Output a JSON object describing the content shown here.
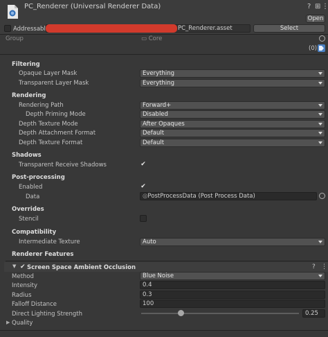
{
  "header": {
    "title": "PC_Renderer (Universal Renderer Data)",
    "open_label": "Open",
    "addressable_label": "Addressable",
    "address_suffix": "PC_Renderer.asset",
    "select_label": "Select",
    "group_label": "Group",
    "group_value": "Core",
    "labels_count": "(0)",
    "folder_glyph": "▭"
  },
  "filtering": {
    "title": "Filtering",
    "opaque_label": "Opaque Layer Mask",
    "opaque_value": "Everything",
    "transparent_label": "Transparent Layer Mask",
    "transparent_value": "Everything"
  },
  "rendering": {
    "title": "Rendering",
    "path_label": "Rendering Path",
    "path_value": "Forward+",
    "priming_label": "Depth Priming Mode",
    "priming_value": "Disabled",
    "texture_mode_label": "Depth Texture Mode",
    "texture_mode_value": "After Opaques",
    "attachment_label": "Depth Attachment Format",
    "attachment_value": "Default",
    "texture_format_label": "Depth Texture Format",
    "texture_format_value": "Default"
  },
  "shadows": {
    "title": "Shadows",
    "receive_label": "Transparent Receive Shadows",
    "receive_checked": true
  },
  "post_processing": {
    "title": "Post-processing",
    "enabled_label": "Enabled",
    "enabled_checked": true,
    "data_label": "Data",
    "data_value": "PostProcessData (Post Process Data)"
  },
  "overrides": {
    "title": "Overrides",
    "stencil_label": "Stencil",
    "stencil_checked": false
  },
  "compatibility": {
    "title": "Compatibility",
    "intermediate_label": "Intermediate Texture",
    "intermediate_value": "Auto"
  },
  "renderer_features": {
    "title": "Renderer Features",
    "ssao": {
      "title": "Screen Space Ambient Occlusion",
      "enabled": true,
      "method_label": "Method",
      "method_value": "Blue Noise",
      "intensity_label": "Intensity",
      "intensity_value": "0.4",
      "radius_label": "Radius",
      "radius_value": "0.3",
      "falloff_label": "Falloff Distance",
      "falloff_value": "100",
      "direct_label": "Direct Lighting Strength",
      "direct_value": "0.25",
      "direct_fraction": 0.25,
      "quality_label": "Quality"
    }
  },
  "glyphs": {
    "check": "✔",
    "help": "?",
    "menu": "⋮",
    "tree_open": "▼",
    "tree_closed": "▶"
  },
  "colors": {
    "background": "#383838",
    "redaction": "#d23a2c",
    "tag_accent": "#4a7fc1"
  }
}
